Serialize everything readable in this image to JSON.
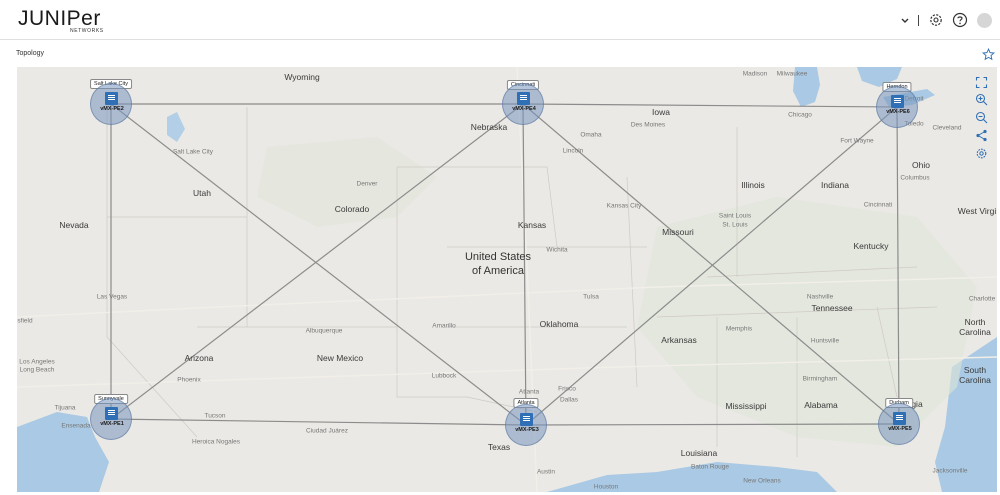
{
  "header": {
    "logo_word": "JUNIPer",
    "logo_sub": "NETWORKS",
    "icons": [
      "chevron-down-icon",
      "gear-icon",
      "help-icon",
      "avatar"
    ]
  },
  "page": {
    "title": "Topology"
  },
  "colors": {
    "accent": "#2f6fb5",
    "node_fill": "#7896be",
    "link": "#8c8c8c",
    "map_land": "#ebe9e5",
    "water": "#a9c9e4"
  },
  "nodes": [
    {
      "tag": "Salt Lake City",
      "name": "vMX-PE2"
    },
    {
      "tag": "Cincinnati",
      "name": "vMX-PE4"
    },
    {
      "tag": "Herndon",
      "name": "vMX-PE6"
    },
    {
      "tag": "Sunnyvale",
      "name": "vMX-PE1"
    },
    {
      "tag": "Atlanta",
      "name": "vMX-PE3"
    },
    {
      "tag": "Durham",
      "name": "vMX-PE5"
    }
  ],
  "map": {
    "states": [
      "Wyoming",
      "Nebraska",
      "Iowa",
      "Utah",
      "Colorado",
      "Nevada",
      "Kansas",
      "Illinois",
      "Indiana",
      "Ohio",
      "Missouri",
      "Kentucky",
      "West Virgi",
      "Oklahoma",
      "Arizona",
      "New Mexico",
      "Arkansas",
      "Tennessee",
      "North Carolina",
      "South Carolina",
      "Mississippi",
      "Alabama",
      "Texas",
      "Louisiana",
      "gia"
    ],
    "cities": [
      "Madison",
      "Milwaukee",
      "Detroit",
      "Chicago",
      "Cleveland",
      "Des Moines",
      "Omaha",
      "Lincoln",
      "Fort Wayne",
      "Toledo",
      "Columbus",
      "Salt Lake City",
      "Denver",
      "Kansas City",
      "Saint Louis",
      "St. Louis",
      "Cincinnati",
      "Wichita",
      "Las Vegas",
      "Tulsa",
      "Nashville",
      "Memphis",
      "Albuquerque",
      "Amarillo",
      "Phoenix",
      "Lubbock",
      "Huntsville",
      "Birmingham",
      "Tucson",
      "Ciudad Juárez",
      "Heroica Nogales",
      "Dallas",
      "Frisco",
      "Ensenada",
      "Tijuana",
      "Austin",
      "Baton Rouge",
      "New Orleans",
      "Houston",
      "Jacksonville",
      "Long Beach",
      "Los Angeles",
      "Atlanta",
      "Charlotte"
    ],
    "country": "United States of America",
    "partial_left": "sfield"
  },
  "tools": [
    "fit-screen-icon",
    "zoom-in-icon",
    "zoom-out-icon",
    "share-icon",
    "settings-icon"
  ]
}
